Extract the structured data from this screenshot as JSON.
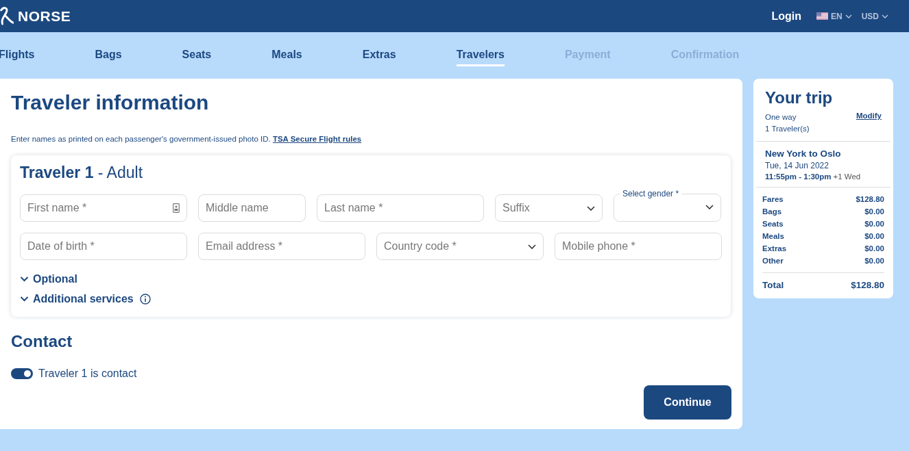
{
  "header": {
    "brand": "NORSE",
    "login": "Login",
    "language": "EN",
    "currency": "USD"
  },
  "steps": [
    {
      "label": "Flights",
      "selected": false,
      "disabled": false
    },
    {
      "label": "Bags",
      "selected": false,
      "disabled": false
    },
    {
      "label": "Seats",
      "selected": false,
      "disabled": false
    },
    {
      "label": "Meals",
      "selected": false,
      "disabled": false
    },
    {
      "label": "Extras",
      "selected": false,
      "disabled": false
    },
    {
      "label": "Travelers",
      "selected": true,
      "disabled": false
    },
    {
      "label": "Payment",
      "selected": false,
      "disabled": true
    },
    {
      "label": "Confirmation",
      "selected": false,
      "disabled": true
    }
  ],
  "page": {
    "title": "Traveler information",
    "note": "Enter names as printed on each passenger's government-issued photo ID.",
    "note_link": "TSA Secure Flight rules"
  },
  "traveler": {
    "heading": "**Traveler 1** - Adult",
    "rows": [
      [
        {
          "kind": "id-input",
          "placeholder": "First name *"
        },
        {
          "kind": "input",
          "placeholder": "Middle name"
        },
        {
          "kind": "input",
          "placeholder": "Last name *"
        },
        {
          "kind": "select",
          "placeholder": "Suffix"
        },
        {
          "kind": "select",
          "label": "Select gender *"
        }
      ],
      [
        {
          "kind": "input",
          "placeholder": "Date of birth *"
        },
        {
          "kind": "input",
          "placeholder": "Email address *"
        },
        {
          "kind": "select",
          "placeholder": "Country code *"
        },
        {
          "kind": "input",
          "placeholder": "Mobile phone *"
        }
      ]
    ],
    "sections": [
      {
        "label": "Optional",
        "expanded": false,
        "info": false
      },
      {
        "label": "Additional services",
        "expanded": false,
        "info": true
      }
    ]
  },
  "contact": {
    "title": "Contact",
    "toggle_label": "Traveler 1 is contact",
    "on": true
  },
  "continue": "Continue",
  "trip": {
    "title": "Your trip",
    "type": "One way",
    "modify": "Modify",
    "travelers": "1 Traveler(s)",
    "route": "New York to Oslo",
    "date": "Tue, 14 Jun 2022",
    "times": "11:55pm - 1:30pm",
    "next_day": "+1 Wed",
    "costs": [
      {
        "label": "Fares",
        "amount": "$128.80"
      },
      {
        "label": "Bags",
        "amount": "$0.00"
      },
      {
        "label": "Seats",
        "amount": "$0.00"
      },
      {
        "label": "Meals",
        "amount": "$0.00"
      },
      {
        "label": "Extras",
        "amount": "$0.00"
      },
      {
        "label": "Other",
        "amount": "$0.00"
      }
    ],
    "total_label": "Total",
    "total": "$128.80"
  }
}
